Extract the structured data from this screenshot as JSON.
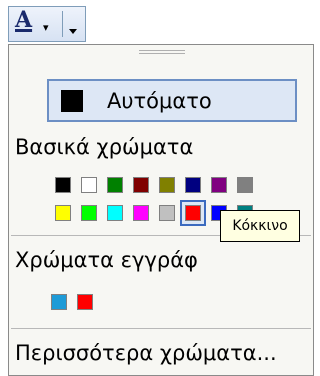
{
  "toolbar": {
    "font_color_letter": "A",
    "dropdown_glyph": "▾"
  },
  "menu": {
    "automatic_label": "Αυτόματο",
    "automatic_color": "#000000",
    "basic_colors_heading": "Βασικά χρώματα",
    "basic_colors_row1": [
      "#000000",
      "#ffffff",
      "#008000",
      "#800000",
      "#808000",
      "#000080",
      "#800080",
      "#808080"
    ],
    "basic_colors_row2": [
      "#ffff00",
      "#00ff00",
      "#00ffff",
      "#ff00ff",
      "#c0c0c0",
      "#ff0000",
      "#0000ff",
      "#008080"
    ],
    "selected_color": "#ff0000",
    "document_colors_heading": "Χρώματα εγγράφ",
    "document_colors": [
      "#1e9bd7",
      "#ff0000"
    ],
    "more_colors_label": "Περισσότερα χρώματα..."
  },
  "tooltip": {
    "text": "Κόκκινο"
  }
}
